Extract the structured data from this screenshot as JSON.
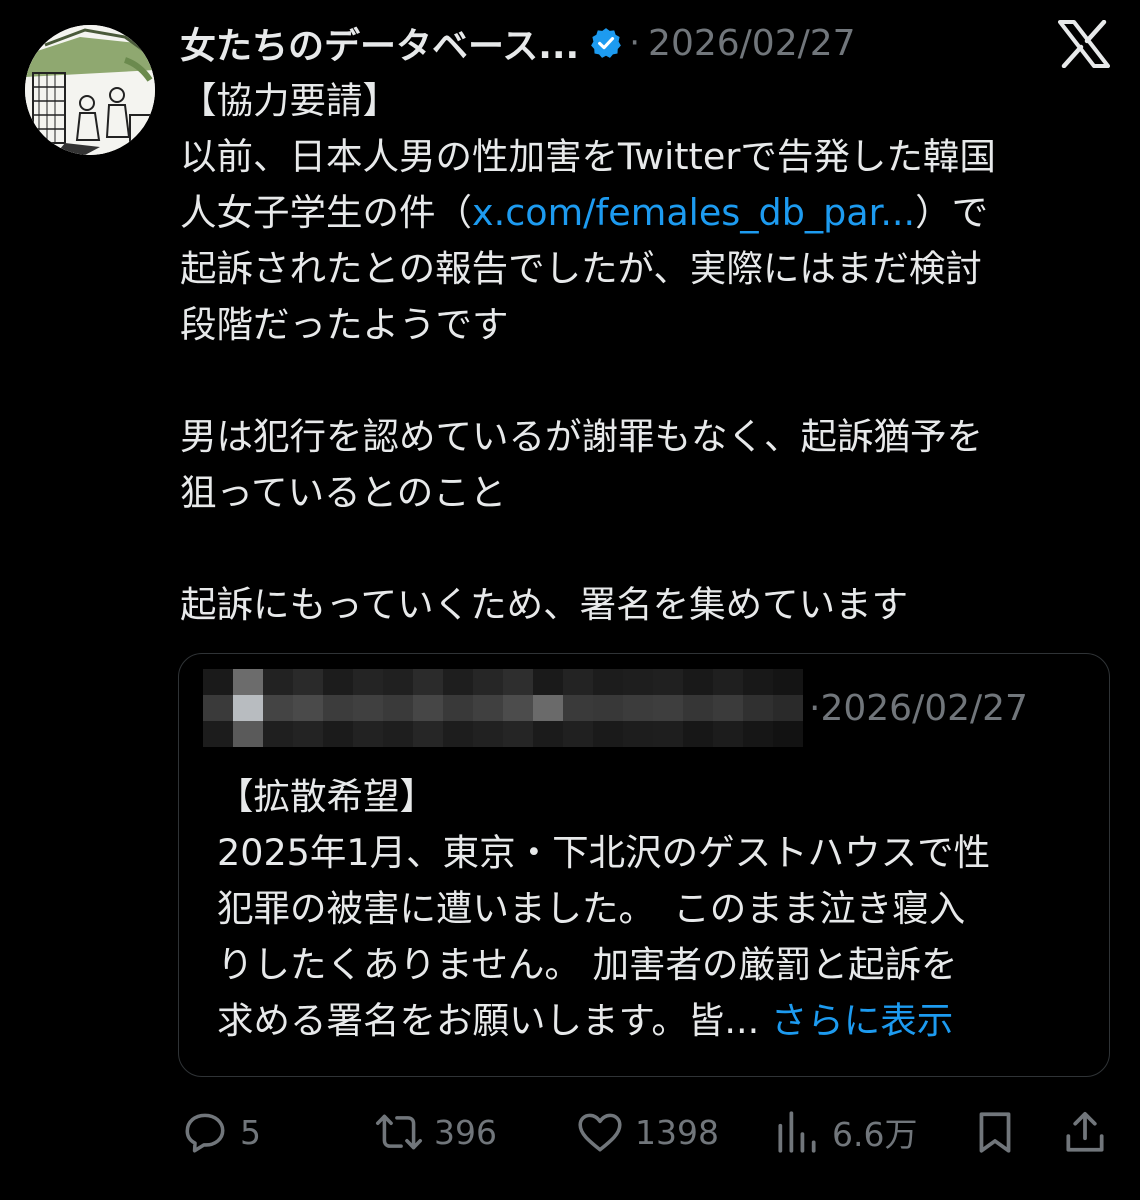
{
  "author": {
    "display_name": "女たちのデータベース...",
    "avatar_icon": "avatar-illustration-icon",
    "verified_icon": "verified-badge-icon",
    "verified_color": "#1d9bf0"
  },
  "tweet": {
    "separator": "·",
    "date": "2026/02/27",
    "brand_icon": "x-logo-icon",
    "lines": [
      {
        "text": "【協力要請】"
      },
      {
        "text": "以前、日本人男の性加害をTwitterで告発した韓国"
      },
      {
        "pre": "人女子学生の件（",
        "link": "x.com/females_db_par...",
        "post": "）で"
      },
      {
        "text": "起訴されたとの報告でしたが、実際にはまだ検討"
      },
      {
        "text": "段階だったようです"
      },
      {
        "text": ""
      },
      {
        "text": "男は犯行を認めているが謝罪もなく、起訴猶予を"
      },
      {
        "text": "狙っているとのこと"
      },
      {
        "text": ""
      },
      {
        "text": "起訴にもっていくため、署名を集めています"
      }
    ]
  },
  "quote": {
    "separator": "·",
    "date": "2026/02/27",
    "lines": [
      "【拡散希望】",
      "2025年1月、東京・下北沢のゲストハウスで性",
      "犯罪の被害に遭いました。　このまま泣き寝入",
      "りしたくありません。 加害者の厳罰と起訴を"
    ],
    "last_line": "求める署名をお願いします。皆",
    "ellipsis": "...",
    "show_more": "さらに表示"
  },
  "actions": {
    "reply": {
      "icon": "reply-icon",
      "count": "5"
    },
    "retweet": {
      "icon": "retweet-icon",
      "count": "396"
    },
    "like": {
      "icon": "heart-icon",
      "count": "1398"
    },
    "views": {
      "icon": "views-chart-icon",
      "count": "6.6万"
    },
    "bookmark": {
      "icon": "bookmark-icon"
    },
    "share": {
      "icon": "share-icon"
    }
  },
  "colors": {
    "background": "#000000",
    "text": "#e7e9ea",
    "secondary": "#71767b",
    "link": "#1d9bf0",
    "border": "#2f3336"
  }
}
